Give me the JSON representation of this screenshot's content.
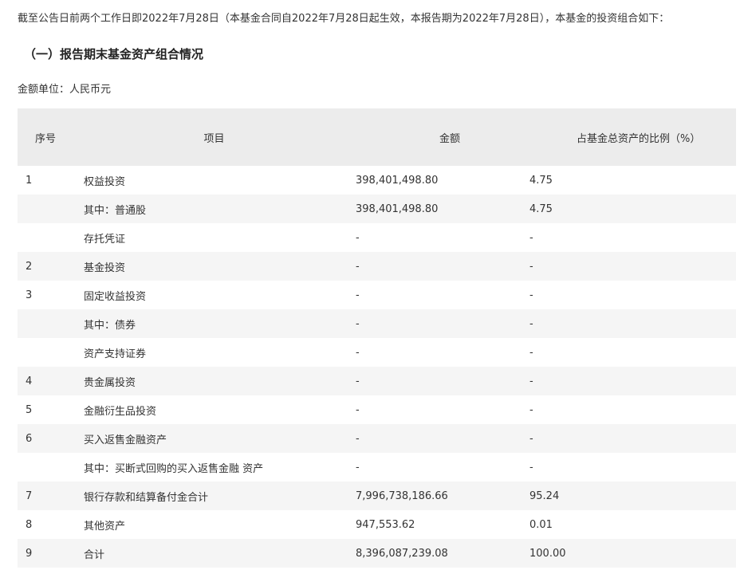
{
  "intro": "截至公告日前两个工作日即2022年7月28日（本基金合同自2022年7月28日起生效，本报告期为2022年7月28日），本基金的投资组合如下：",
  "section_title": "（一）报告期末基金资产组合情况",
  "unit": "金额单位：人民币元",
  "table": {
    "headers": {
      "no": "序号",
      "item": "项目",
      "amount": "金额",
      "ratio": "占基金总资产的比例（%）"
    },
    "rows": [
      {
        "no": "1",
        "item": "权益投资",
        "amount": "398,401,498.80",
        "ratio": "4.75"
      },
      {
        "no": "",
        "item": "其中：普通股",
        "amount": "398,401,498.80",
        "ratio": "4.75"
      },
      {
        "no": "",
        "item": "存托凭证",
        "amount": "-",
        "ratio": "-"
      },
      {
        "no": "2",
        "item": "基金投资",
        "amount": "-",
        "ratio": "-"
      },
      {
        "no": "3",
        "item": "固定收益投资",
        "amount": "-",
        "ratio": "-"
      },
      {
        "no": "",
        "item": "其中：债券",
        "amount": "-",
        "ratio": "-"
      },
      {
        "no": "",
        "item": "资产支持证券",
        "amount": "-",
        "ratio": "-"
      },
      {
        "no": "4",
        "item": "贵金属投资",
        "amount": "-",
        "ratio": "-"
      },
      {
        "no": "5",
        "item": "金融衍生品投资",
        "amount": "-",
        "ratio": "-"
      },
      {
        "no": "6",
        "item": "买入返售金融资产",
        "amount": "-",
        "ratio": "-"
      },
      {
        "no": "",
        "item": "其中：买断式回购的买入返售金融 资产",
        "amount": "-",
        "ratio": "-"
      },
      {
        "no": "7",
        "item": "银行存款和结算备付金合计",
        "amount": "7,996,738,186.66",
        "ratio": "95.24"
      },
      {
        "no": "8",
        "item": "其他资产",
        "amount": "947,553.62",
        "ratio": "0.01"
      },
      {
        "no": "9",
        "item": "合计",
        "amount": "8,396,087,239.08",
        "ratio": "100.00"
      }
    ]
  }
}
